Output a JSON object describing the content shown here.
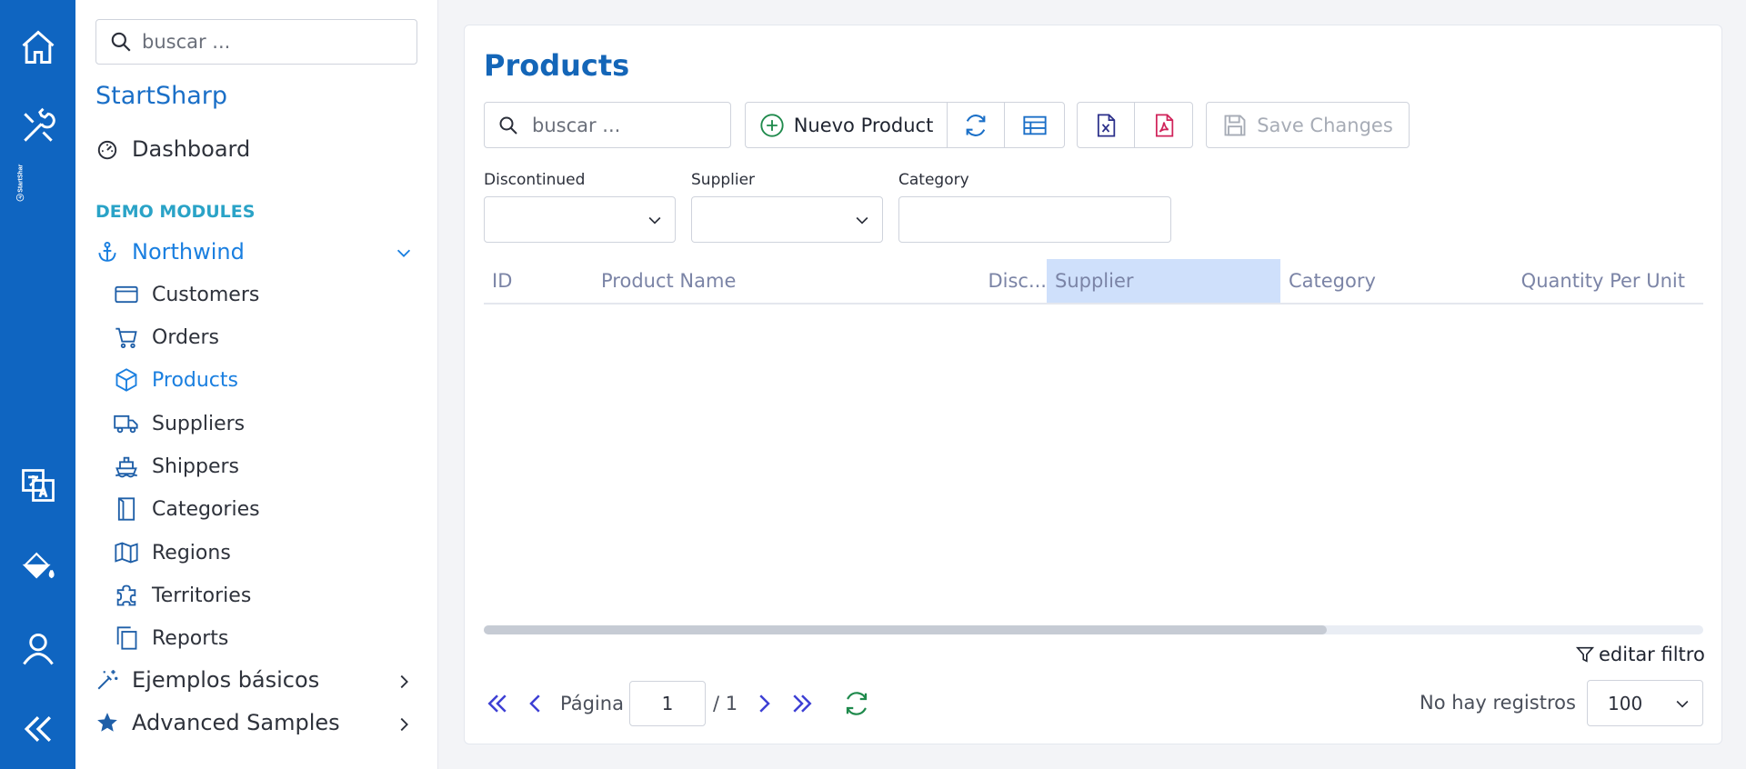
{
  "rail": {
    "brand_text": "StartShar",
    "icons": [
      "home-icon",
      "tools-icon",
      "logo-icon",
      "translate-icon",
      "paint-bucket-icon",
      "user-icon",
      "collapse-icon"
    ]
  },
  "sidebar": {
    "search_placeholder": "buscar ...",
    "app_name": "StartSharp",
    "dashboard": "Dashboard",
    "section_title": "DEMO MODULES",
    "northwind": "Northwind",
    "items": [
      {
        "label": "Customers",
        "icon": "card-icon"
      },
      {
        "label": "Orders",
        "icon": "cart-icon"
      },
      {
        "label": "Products",
        "icon": "box-icon",
        "active": true
      },
      {
        "label": "Suppliers",
        "icon": "truck-icon"
      },
      {
        "label": "Shippers",
        "icon": "ship-icon"
      },
      {
        "label": "Categories",
        "icon": "category-icon"
      },
      {
        "label": "Regions",
        "icon": "map-icon"
      },
      {
        "label": "Territories",
        "icon": "puzzle-icon"
      },
      {
        "label": "Reports",
        "icon": "copy-icon"
      }
    ],
    "basic_samples": "Ejemplos básicos",
    "advanced_samples": "Advanced Samples"
  },
  "main": {
    "title": "Products",
    "search_placeholder": "buscar ...",
    "new_button": "Nuevo Product",
    "save_button": "Save Changes",
    "filters": {
      "discontinued_label": "Discontinued",
      "supplier_label": "Supplier",
      "category_label": "Category"
    },
    "columns": [
      "ID",
      "Product Name",
      "Disc...",
      "Supplier",
      "Category",
      "Quantity Per Unit"
    ],
    "edit_filter": "editar filtro",
    "pager": {
      "page_label": "Página",
      "page_value": "1",
      "of_label": "/ 1",
      "no_records": "No hay registros",
      "page_size": "100"
    }
  },
  "colors": {
    "accent": "#0f65c1",
    "title": "#1466b8",
    "section": "#2aa3c7",
    "sorted_column": "#cfe0fb"
  }
}
